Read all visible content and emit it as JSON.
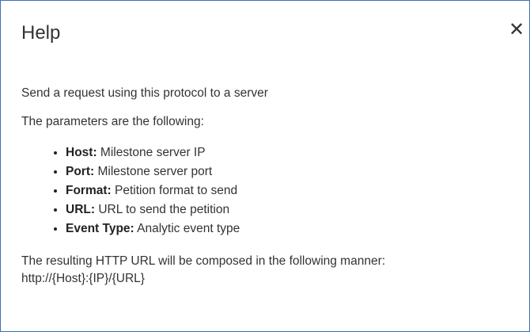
{
  "dialog": {
    "title": "Help",
    "close_glyph": "✕",
    "close_icon": "close-icon"
  },
  "content": {
    "intro": "Send a request using this protocol to a server",
    "params_heading": "The parameters are the following:",
    "params": [
      {
        "name": "Host:",
        "description": "Milestone server IP"
      },
      {
        "name": "Port:",
        "description": "Milestone server port"
      },
      {
        "name": "Format:",
        "description": "Petition format to send"
      },
      {
        "name": "URL:",
        "description": "URL to send the petition"
      },
      {
        "name": "Event Type:",
        "description": "Analytic event type"
      }
    ],
    "result_text": "The resulting HTTP URL will be composed in the following manner:",
    "result_url": "http://{Host}:{IP}/{URL}"
  },
  "colors": {
    "border": "#3f6fb6",
    "text": "#333333"
  }
}
